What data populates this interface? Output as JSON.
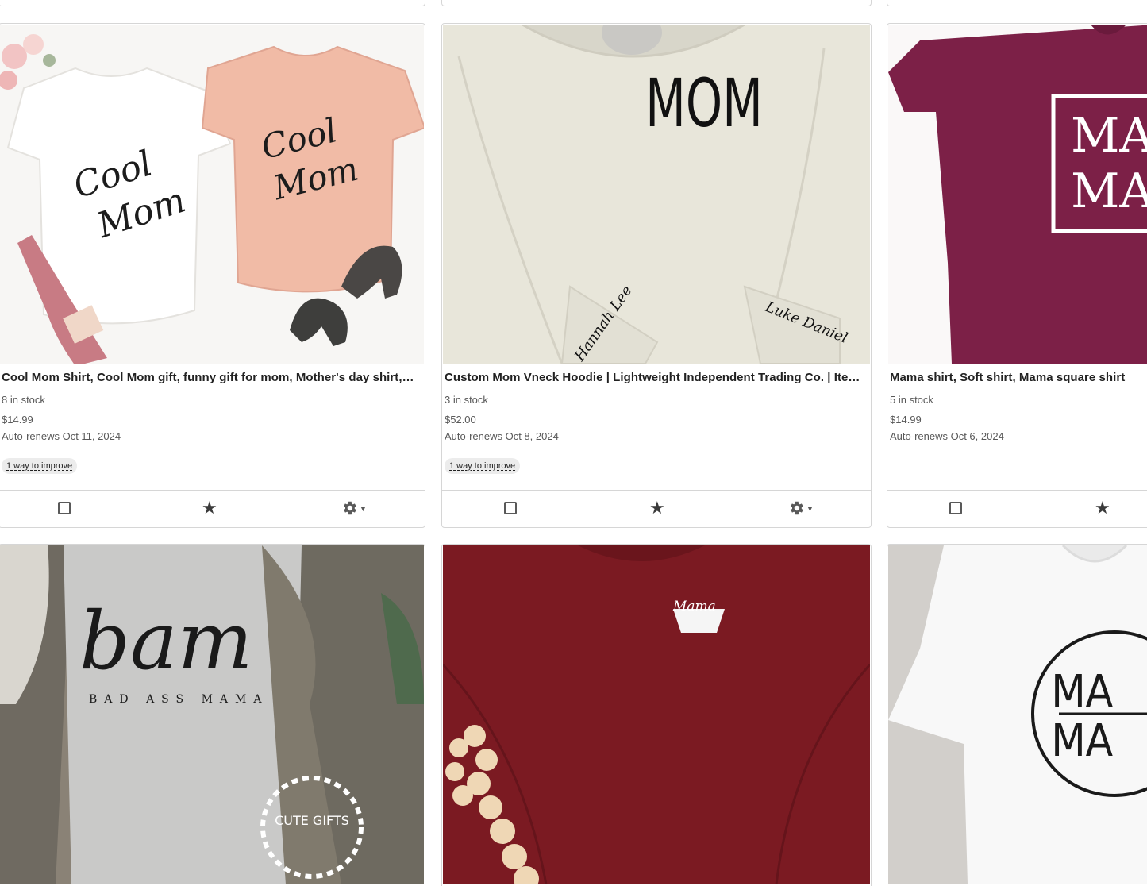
{
  "listings": [
    {
      "title": "Cool Mom Shirt, Cool Mom gift, funny gift for mom, Mother's day shirt, Cool Mom Tee",
      "stock": "8 in stock",
      "price": "$14.99",
      "renew": "Auto-renews Oct 11, 2024",
      "improve": "1 way to improve",
      "image_text_1": "Cool",
      "image_text_2": "Mom"
    },
    {
      "title": "Custom Mom Vneck Hoodie | Lightweight Independent Trading Co. | Items",
      "stock": "3 in stock",
      "price": "$52.00",
      "renew": "Auto-renews Oct 8, 2024",
      "improve": "1 way to improve",
      "image_text_1": "MOM",
      "image_text_2": "Hannah Lee",
      "image_text_3": "Luke Daniel"
    },
    {
      "title": "Mama shirt, Soft shirt, Mama square shirt",
      "stock": "5 in stock",
      "price": "$14.99",
      "renew": "Auto-renews Oct 6, 2024",
      "image_text_1": "MA",
      "image_text_2": "MA"
    },
    {
      "image_text_1": "bam",
      "image_text_2": "BAD ASS MAMA",
      "image_text_3": "CUTE GIFTS"
    },
    {
      "image_text_1": "Mama"
    },
    {
      "image_text_1": "MA",
      "image_text_2": "MA"
    }
  ],
  "icons": {
    "checkbox": "checkbox-icon",
    "star": "star-icon",
    "gear": "gear-icon",
    "caret": "caret-down-icon"
  },
  "colors": {
    "card_border": "#d6d6d6",
    "muted_text": "#595959",
    "pill_bg": "#ececec"
  }
}
